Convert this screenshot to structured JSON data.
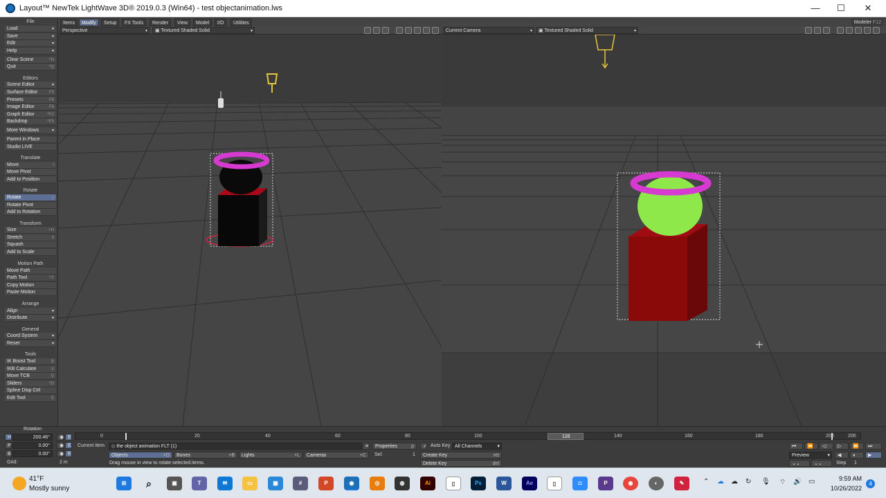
{
  "window": {
    "title": "Layout™ NewTek LightWave 3D® 2019.0.3 (Win64) - test objectanimation.lws",
    "minimize": "—",
    "maximize": "☐",
    "close": "✕"
  },
  "menu_tabs": [
    "Items",
    "Modify",
    "Setup",
    "FX Tools",
    "Render",
    "View",
    "Model",
    "I/O",
    "Utilities"
  ],
  "menu_active": "Modify",
  "modeler_button": "Modeler",
  "modeler_shortcut": "F12",
  "sidebar": {
    "file_head": "File",
    "file_items": [
      {
        "label": "Load",
        "dd": "▾"
      },
      {
        "label": "Save",
        "dd": "▾"
      },
      {
        "label": "Edit",
        "dd": "▾"
      },
      {
        "label": "Help",
        "dd": "▾"
      }
    ],
    "file_items2": [
      {
        "label": "Clear Scene",
        "sc": "^N"
      },
      {
        "label": "Quit",
        "sc": "^Q"
      }
    ],
    "editors_head": "Editors",
    "editors_items": [
      {
        "label": "Scene Editor",
        "sc": "▾"
      },
      {
        "label": "Surface Editor",
        "sc": "F5"
      },
      {
        "label": "Presets",
        "sc": "F8"
      },
      {
        "label": "Image Editor",
        "sc": "F6"
      },
      {
        "label": "Graph Editor",
        "sc": "^F2"
      },
      {
        "label": "Backdrop",
        "sc": "^F5"
      },
      {
        "label": "More Windows",
        "sc": "▾"
      }
    ],
    "editors_items2": [
      {
        "label": "Parent in Place",
        "sc": ""
      },
      {
        "label": "Studio LIVE",
        "sc": ""
      }
    ],
    "translate_head": "Translate",
    "translate_items": [
      {
        "label": "Move",
        "sc": "t"
      },
      {
        "label": "Move Pivot",
        "sc": ""
      },
      {
        "label": "Add to Position",
        "sc": ""
      }
    ],
    "rotate_head": "Rotate",
    "rotate_items": [
      {
        "label": "Rotate",
        "sc": "y"
      },
      {
        "label": "Rotate Pivot",
        "sc": ""
      },
      {
        "label": "Add to Rotation",
        "sc": ""
      }
    ],
    "transform_head": "Transform",
    "transform_items": [
      {
        "label": "Size",
        "sc": "+H"
      },
      {
        "label": "Stretch",
        "sc": "h"
      },
      {
        "label": "Squash",
        "sc": ""
      },
      {
        "label": "Add to Scale",
        "sc": ""
      }
    ],
    "motion_head": "Motion Path",
    "motion_items": [
      {
        "label": "Move Path",
        "sc": ""
      },
      {
        "label": "Path Tool",
        "sc": "^Y"
      },
      {
        "label": "Copy Motion",
        "sc": ""
      },
      {
        "label": "Paste Motion",
        "sc": ""
      }
    ],
    "arrange_head": "Arrange",
    "arrange_items": [
      {
        "label": "Align",
        "sc": "▾"
      },
      {
        "label": "Distribute",
        "sc": "▾"
      }
    ],
    "general_head": "General",
    "general_items": [
      {
        "label": "Coord System",
        "sc": "▾"
      },
      {
        "label": "Reset",
        "sc": "▾"
      }
    ],
    "tools_head": "Tools",
    "tools_items": [
      {
        "label": "IK Boost Tool",
        "sc": "B"
      },
      {
        "label": "IKB Calculate",
        "sc": "X"
      },
      {
        "label": "Move TCB",
        "sc": "G"
      },
      {
        "label": "Sliders",
        "sc": "^D"
      },
      {
        "label": "Spline Disp Ctrl",
        "sc": ""
      },
      {
        "label": "Edit Tool",
        "sc": "E"
      }
    ]
  },
  "viewport_left": {
    "view": "Perspective",
    "shading": "Textured Shaded Solid"
  },
  "viewport_right": {
    "view": "Current Camera",
    "shading": "Textured Shaded Solid"
  },
  "colors": {
    "torus": "#d63ad0",
    "sphere_left": "#0a0a0a",
    "sphere_right": "#8fe84a",
    "box_left": "#080808",
    "box_right": "#8a0a0a",
    "light": "#e8c640",
    "selection": "#d0243e"
  },
  "bottom": {
    "rotation_label": "Rotation",
    "h_label": "H",
    "h_value": "200.46°",
    "p_label": "P",
    "p_value": "0.00°",
    "b_label": "B",
    "b_value": "0.00°",
    "grid_label": "Grid:",
    "grid_value": "2 m",
    "e_label": "E",
    "current_item_label": "Current Item",
    "current_item": "the object animation FLT (1)",
    "objects": "Objects",
    "objects_sc": "+O",
    "bones": "Bones",
    "bones_sc": "+B",
    "lights": "Lights",
    "lights_sc": "+L",
    "cameras": "Cameras",
    "cameras_sc": "+C",
    "properties": "Properties",
    "properties_sc": "p",
    "sel_label": "Sel:",
    "sel_value": "1",
    "auto_key": "Auto Key",
    "all_channels": "All Channels",
    "create_key": "Create Key",
    "create_key_sc": "ret",
    "delete_key": "Delete Key",
    "delete_key_sc": "del",
    "hint": "Drag mouse in view to rotate selected items.",
    "timeline_ticks": [
      "0",
      "20",
      "40",
      "60",
      "80",
      "100",
      "120",
      "140",
      "160",
      "180",
      "200"
    ],
    "timeline_start": "0",
    "timeline_end": "200",
    "current_frame": "126",
    "preview": "Preview",
    "step_label": "Step",
    "step_value": "1"
  },
  "taskbar": {
    "temp": "41°F",
    "weather": "Mostly sunny",
    "time": "9:59 AM",
    "date": "10/26/2022",
    "notif_count": "4",
    "apps": [
      "windows-start",
      "search",
      "task-view",
      "teams",
      "mail",
      "file-explorer",
      "store",
      "calculator",
      "powerpoint",
      "lightwave",
      "blender",
      "davinci",
      "illustrator",
      "notepad",
      "photoshop",
      "word",
      "after-effects",
      "file",
      "zoom",
      "phpstorm",
      "chrome",
      "unity",
      "autodesk"
    ]
  }
}
